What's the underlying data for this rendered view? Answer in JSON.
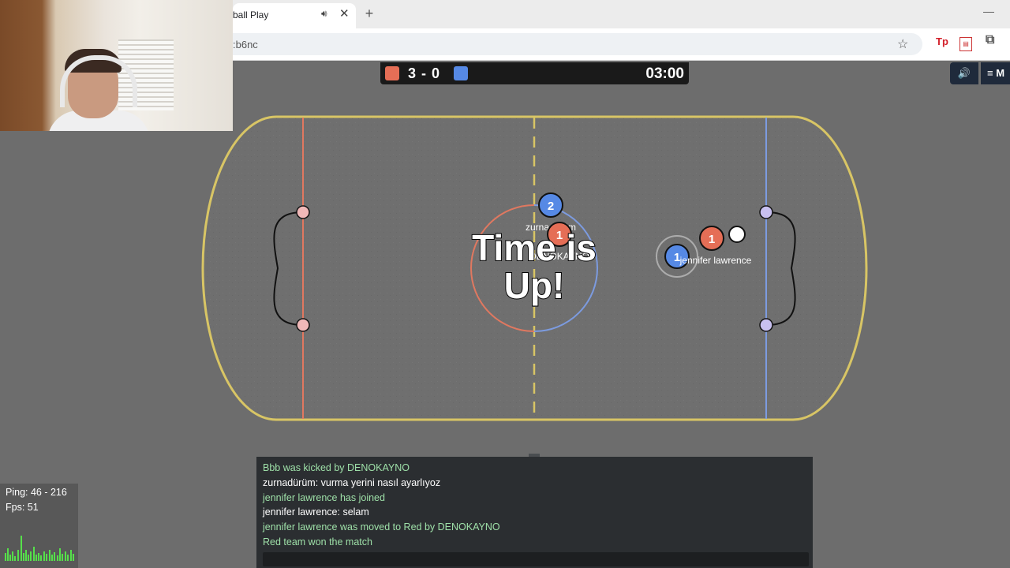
{
  "browser": {
    "tab_title": "ball Play",
    "tab_audio_icon": "speaker-icon",
    "tab_close": "✕",
    "new_tab": "+",
    "url": ":b6nc",
    "extension_tp": "Tp"
  },
  "scoreboard": {
    "score": "3 - 0",
    "timer": "03:00",
    "red_color": "#e56e56",
    "blue_color": "#5689e5"
  },
  "hud": {
    "sound_icon": "🔊",
    "menu_label": "≡ M"
  },
  "field": {
    "message_line1": "Time is",
    "message_line2": "Up!",
    "players": [
      {
        "team": "blue",
        "number": "2",
        "name": "zurnadürüm"
      },
      {
        "team": "red",
        "number": "1",
        "name": "DENOKAYNO"
      },
      {
        "team": "blue",
        "number": "1",
        "name": ""
      },
      {
        "team": "red",
        "number": "1",
        "name": "jennifer lawrence"
      }
    ]
  },
  "chat": {
    "lines": [
      {
        "type": "notice",
        "text": "Bbb was kicked by DENOKAYNO"
      },
      {
        "type": "msg",
        "text": "zurnadürüm: vurma yerini nasıl ayarlıyoz"
      },
      {
        "type": "notice",
        "text": "jennifer lawrence has joined"
      },
      {
        "type": "msg",
        "text": "jennifer lawrence: selam"
      },
      {
        "type": "notice",
        "text": "jennifer lawrence was moved to Red by DENOKAYNO"
      },
      {
        "type": "notice",
        "text": "Red team won the match"
      }
    ]
  },
  "stats": {
    "ping": "Ping: 46 - 216",
    "fps": "Fps: 51"
  }
}
